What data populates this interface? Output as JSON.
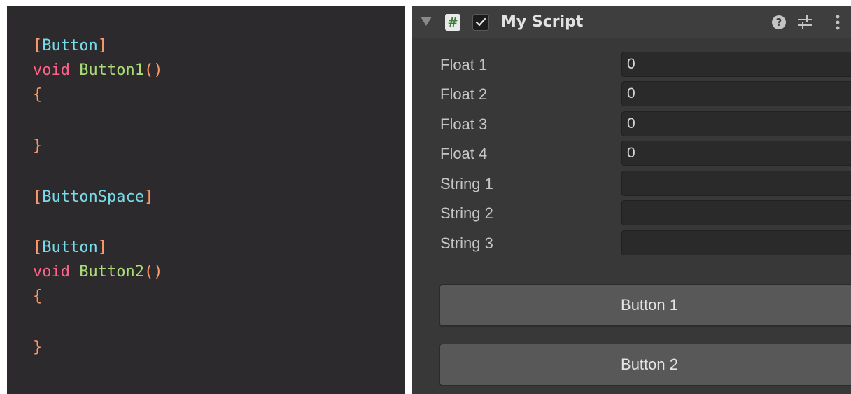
{
  "code": {
    "lines": [
      {
        "attr_open": "[",
        "attr": "Button",
        "attr_close": "]"
      },
      {
        "keyword": "void",
        "name": "Button1",
        "parens": "()"
      },
      {
        "brace": "{"
      },
      {
        "brace": "}"
      },
      {
        "attr_open": "[",
        "attr": "ButtonSpace",
        "attr_close": "]"
      },
      {
        "attr_open": "[",
        "attr": "Button",
        "attr_close": "]"
      },
      {
        "keyword": "void",
        "name": "Button2",
        "parens": "()"
      },
      {
        "brace": "{"
      },
      {
        "brace": "}"
      }
    ],
    "colors": {
      "background": "#2d2a2e",
      "attribute": "#78dce8",
      "keyword": "#ff6188",
      "function": "#a9dc76",
      "punctuation": "#fc9867"
    }
  },
  "inspector": {
    "header": {
      "title": "My Script",
      "script_icon_glyph": "#",
      "enabled": true,
      "icons": [
        "foldout-arrow-icon",
        "script-icon",
        "checkbox-icon",
        "help-icon",
        "presets-icon",
        "kebab-menu-icon"
      ]
    },
    "fields": [
      {
        "label": "Float 1",
        "value": "0"
      },
      {
        "label": "Float 2",
        "value": "0"
      },
      {
        "label": "Float 3",
        "value": "0"
      },
      {
        "label": "Float 4",
        "value": "0"
      },
      {
        "label": "String 1",
        "value": ""
      },
      {
        "label": "String 2",
        "value": ""
      },
      {
        "label": "String 3",
        "value": ""
      }
    ],
    "buttons": [
      {
        "label": "Button 1"
      },
      {
        "label": "Button 2"
      }
    ],
    "colors": {
      "panel": "#383838",
      "header": "#3e3e3e",
      "field": "#2a2a2a",
      "button": "#585858",
      "script_icon_hash": "#3a7d3a"
    }
  }
}
